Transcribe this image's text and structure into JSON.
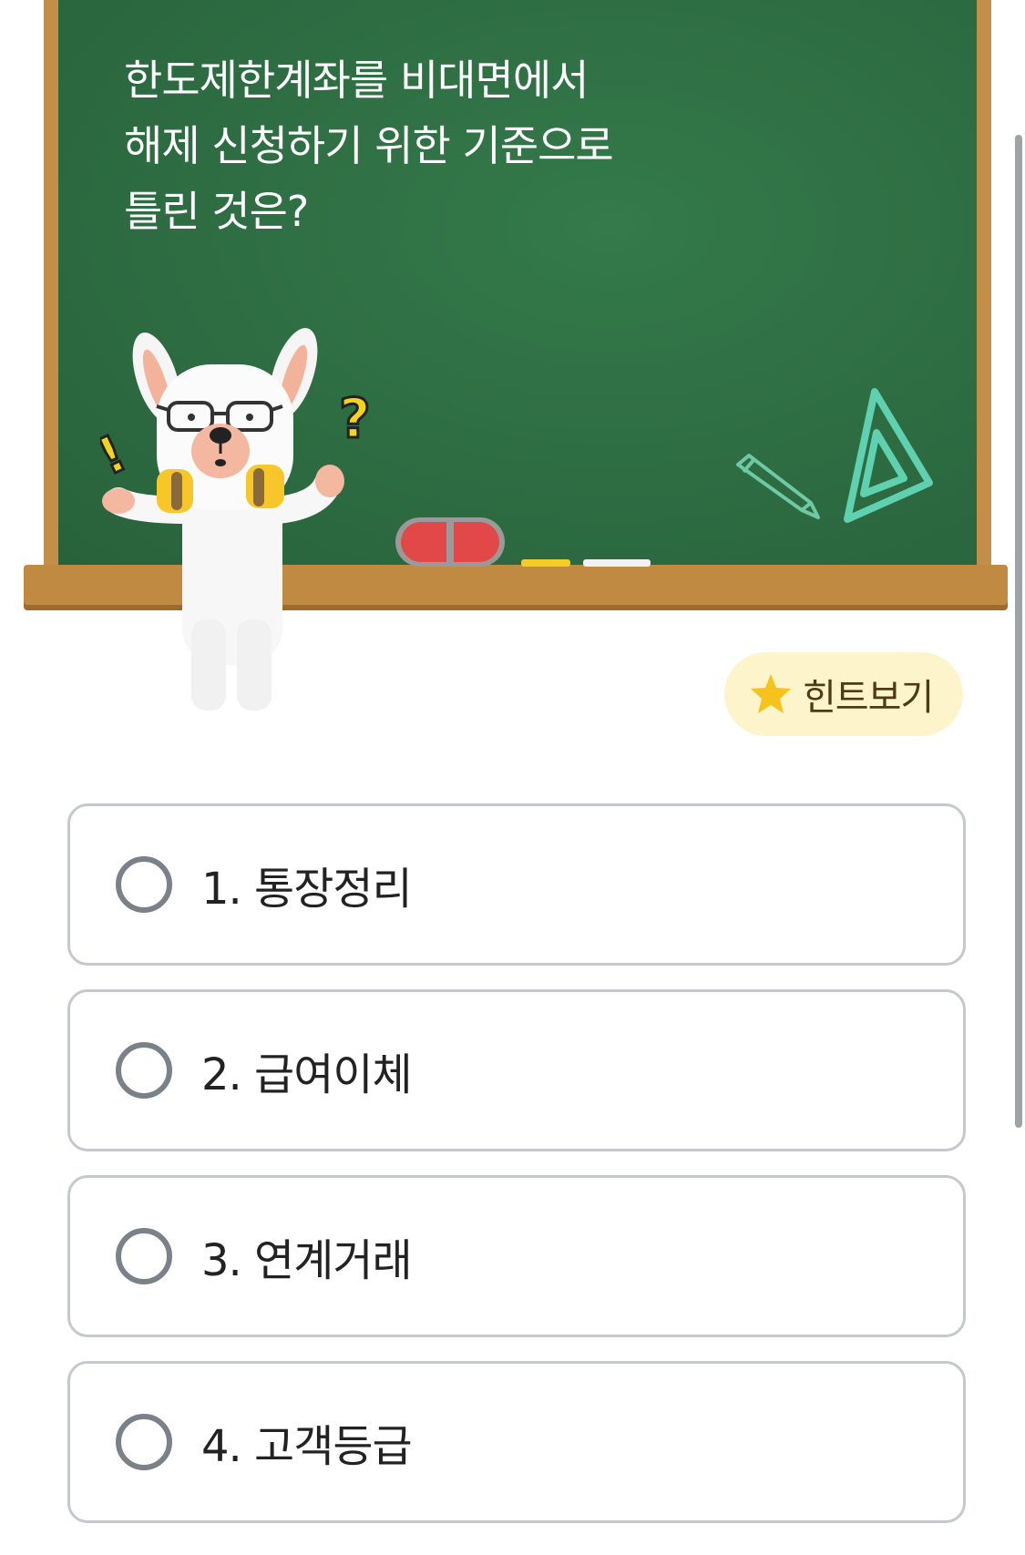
{
  "question": {
    "lines": [
      "한도제한계좌를 비대면에서",
      "해제 신청하기 위한 기준으로",
      "틀린 것은?"
    ]
  },
  "hint": {
    "label": "힌트보기",
    "icon": "star-icon"
  },
  "options": [
    {
      "label": "1. 통장정리"
    },
    {
      "label": "2. 급여이체"
    },
    {
      "label": "3. 연계거래"
    },
    {
      "label": "4. 고객등급"
    }
  ],
  "colors": {
    "board": "#2e6e42",
    "frame": "#c08a43",
    "hint_bg": "#fdf4cc",
    "option_border": "#c5c9cf",
    "radio": "#7a8189"
  }
}
